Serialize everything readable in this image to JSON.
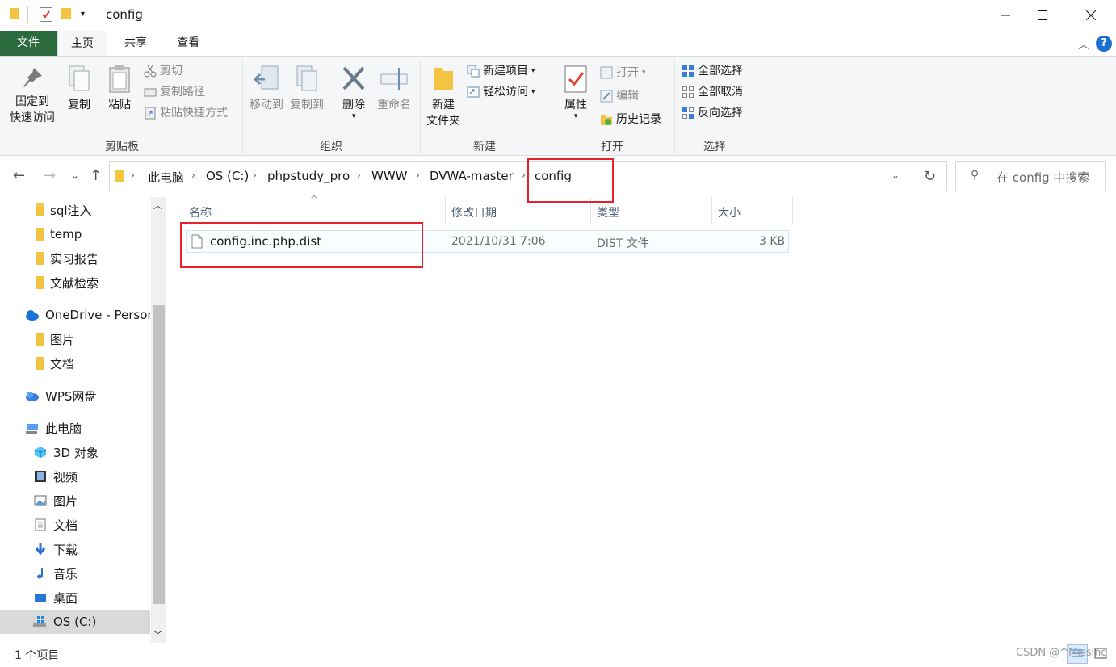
{
  "window": {
    "title": "config"
  },
  "ribbon_tabs": {
    "file": "文件",
    "home": "主页",
    "share": "共享",
    "view": "查看"
  },
  "clipboard": {
    "pin_line1": "固定到",
    "pin_line2": "快速访问",
    "copy": "复制",
    "paste": "粘贴",
    "cut": "剪切",
    "copy_path": "复制路径",
    "paste_shortcut": "粘贴快捷方式",
    "label": "剪贴板"
  },
  "organize": {
    "move_to": "移动到",
    "copy_to": "复制到",
    "delete": "删除",
    "rename": "重命名",
    "label": "组织"
  },
  "new_group": {
    "new_folder_line1": "新建",
    "new_folder_line2": "文件夹",
    "new_item": "新建项目",
    "easy_access": "轻松访问",
    "label": "新建"
  },
  "open_group": {
    "properties": "属性",
    "open": "打开",
    "edit": "编辑",
    "history": "历史记录",
    "label": "打开"
  },
  "select_group": {
    "select_all": "全部选择",
    "select_none": "全部取消",
    "invert": "反向选择",
    "label": "选择"
  },
  "address": {
    "crumbs": [
      "此电脑",
      "OS (C:)",
      "phpstudy_pro",
      "WWW",
      "DVWA-master",
      "config"
    ]
  },
  "search": {
    "placeholder": "在 config 中搜索"
  },
  "nav": {
    "items": [
      "sql注入",
      "temp",
      "实习报告",
      "文献检索",
      "OneDrive - Personal",
      "图片",
      "文档",
      "WPS网盘",
      "此电脑",
      "3D 对象",
      "视频",
      "图片",
      "文档",
      "下载",
      "音乐",
      "桌面",
      "OS (C:)"
    ]
  },
  "columns": {
    "name": "名称",
    "modified": "修改日期",
    "type": "类型",
    "size": "大小"
  },
  "files": [
    {
      "name": "config.inc.php.dist",
      "modified": "2021/10/31 7:06",
      "type": "DIST 文件",
      "size": "3 KB"
    }
  ],
  "status": {
    "count": "1 个项目"
  },
  "watermark": "CSDN @^Missing"
}
